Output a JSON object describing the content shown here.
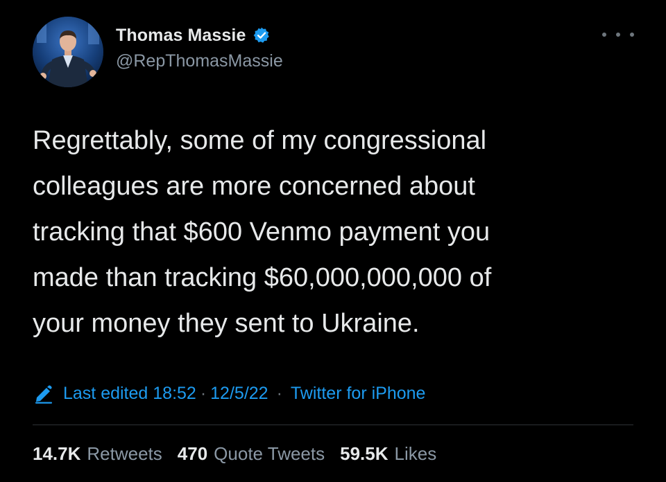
{
  "author": {
    "display_name": "Thomas Massie",
    "handle": "@RepThomasMassie",
    "verified": true,
    "avatar": "avatar-photo"
  },
  "tweet": {
    "text": "Regrettably, some of my congressional\ncolleagues are more concerned about\ntracking that $600 Venmo payment you\nmade than tracking $60,000,000,000 of\nyour money they sent to Ukraine."
  },
  "meta": {
    "edited_label": "Last edited 18:52",
    "date": "12/5/22",
    "source": "Twitter for iPhone",
    "edit_icon": "pencil-edit-icon"
  },
  "stats": {
    "retweets_count": "14.7K",
    "retweets_label": "Retweets",
    "quotes_count": "470",
    "quotes_label": "Quote Tweets",
    "likes_count": "59.5K",
    "likes_label": "Likes"
  },
  "colors": {
    "background": "#000000",
    "text": "#e7e9ea",
    "secondary": "#8b98a5",
    "accent": "#1d9bf0"
  }
}
